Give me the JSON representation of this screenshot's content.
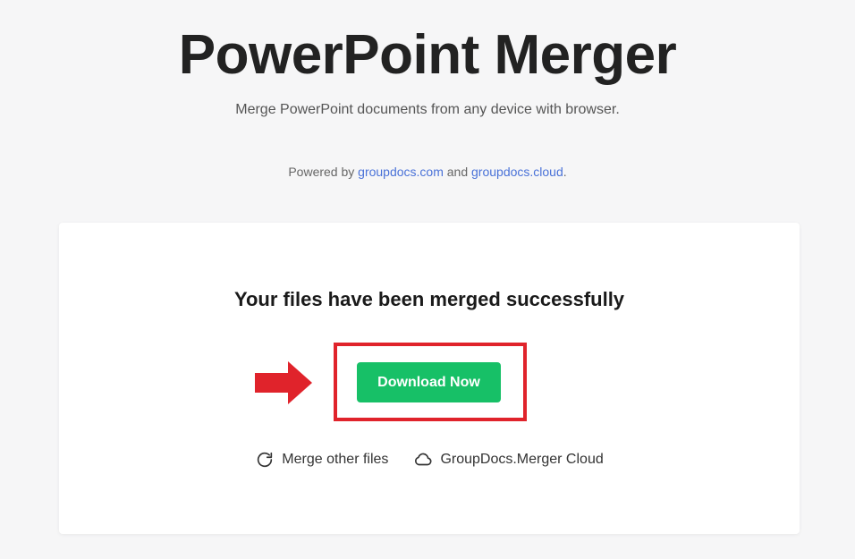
{
  "header": {
    "title": "PowerPoint Merger",
    "subtitle": "Merge PowerPoint documents from any device with browser."
  },
  "powered": {
    "prefix": "Powered by ",
    "link1": "groupdocs.com",
    "middle": " and ",
    "link2": "groupdocs.cloud",
    "suffix": "."
  },
  "result": {
    "message": "Your files have been merged successfully",
    "download_label": "Download Now",
    "merge_other_label": "Merge other files",
    "cloud_label": "GroupDocs.Merger Cloud"
  },
  "icons": {
    "merge_other": "refresh-icon",
    "cloud": "cloud-icon",
    "arrow": "arrow-right-icon"
  },
  "colors": {
    "download_button": "#17c067",
    "highlight": "#e0232b",
    "link": "#4a72d8"
  }
}
